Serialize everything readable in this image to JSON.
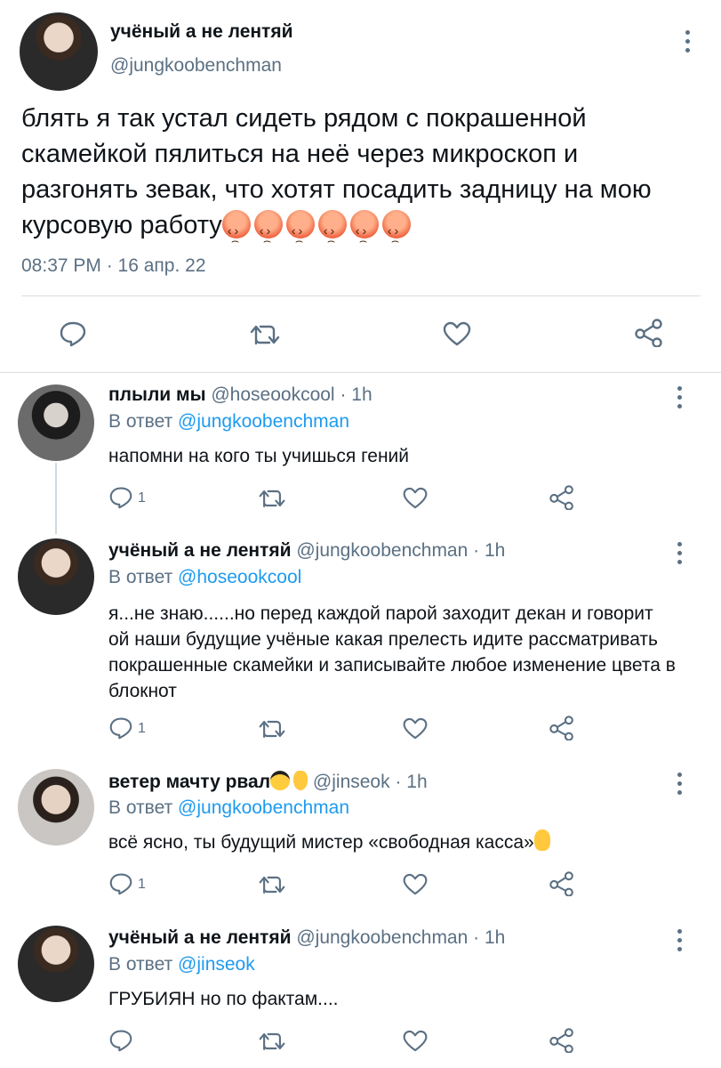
{
  "main_tweet": {
    "author_name": "учёный а не лентяй",
    "author_handle": "@jungkoobenchman",
    "text": "блять я так устал сидеть рядом с покрашенной скамейкой пялиться на неё через микроскоп и разгонять зевак, что хотят посадить задницу на мою курсовую работу",
    "emoji_name": "angry-face-emoji",
    "emoji_count": 6,
    "timestamp": "08:37 PM · 16 апр. 22"
  },
  "icons": {
    "reply": "reply-icon",
    "retweet": "retweet-icon",
    "like": "heart-icon",
    "share": "share-icon",
    "more": "more-options-icon"
  },
  "colors": {
    "link": "#1d9bf0",
    "secondary_text": "#5b7083",
    "divider": "#d9dee2"
  },
  "replies": [
    {
      "author_name": "плыли мы",
      "author_handle": "@hoseookcool",
      "time_ago": "· 1h",
      "reply_prefix": "В ответ",
      "reply_to": "@jungkoobenchman",
      "text": "напомни на кого ты учишься гений",
      "reply_count": "1"
    },
    {
      "author_name": "учёный а не лентяй",
      "author_handle": "@jungkoobenchman",
      "time_ago": "· 1h",
      "reply_prefix": "В ответ",
      "reply_to": "@hoseookcool",
      "text": "я...не знаю......но перед каждой парой заходит декан и говорит ой наши будущие учёные какая прелесть идите рассматривать покрашенные скамейки и записывайте любое изменение цвета в блокнот",
      "reply_count": "1"
    },
    {
      "author_name": "ветер мачту рвал",
      "author_name_emojis": [
        "smiling-face-with-sunglasses-emoji",
        "crossed-fingers-emoji"
      ],
      "author_handle": "@jinseok",
      "time_ago": "· 1h",
      "reply_prefix": "В ответ",
      "reply_to": "@jungkoobenchman",
      "text": "всё ясно, ты будущий мистер «свободная касса»",
      "text_emoji": "raised-hand-emoji",
      "reply_count": "1"
    },
    {
      "author_name": "учёный а не лентяй",
      "author_handle": "@jungkoobenchman",
      "time_ago": "· 1h",
      "reply_prefix": "В ответ",
      "reply_to": "@jinseok",
      "text": "ГРУБИЯН но по фактам....",
      "reply_count": ""
    }
  ]
}
